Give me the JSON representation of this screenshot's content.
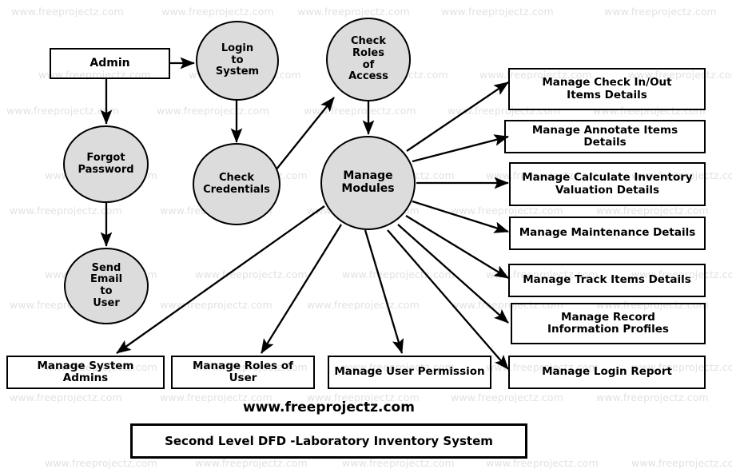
{
  "diagram": {
    "type": "Data Flow Diagram",
    "title": "Second Level DFD -Laboratory Inventory System",
    "brand": "www.freeprojectz.com",
    "watermark_text": "www.freeprojectz.com",
    "colors": {
      "process_fill": "#dcdcdc",
      "stroke": "#000000",
      "background": "#ffffff",
      "watermark": "#e2e2e2"
    }
  },
  "external_entities": [
    {
      "id": "admin",
      "label": "Admin"
    }
  ],
  "processes": [
    {
      "id": "login",
      "label": "Login\nto\nSystem",
      "lines": [
        "Login",
        "to",
        "System"
      ]
    },
    {
      "id": "roles",
      "label": "Check\nRoles\nof\nAccess",
      "lines": [
        "Check",
        "Roles",
        "of",
        "Access"
      ]
    },
    {
      "id": "forgot",
      "label": "Forgot\nPassword",
      "lines": [
        "Forgot",
        "Password"
      ]
    },
    {
      "id": "credentials",
      "label": "Check\nCredentials",
      "lines": [
        "Check",
        "Credentials"
      ]
    },
    {
      "id": "modules",
      "label": "Manage\nModules",
      "lines": [
        "Manage",
        "Modules"
      ]
    },
    {
      "id": "sendmail",
      "label": "Send\nEmail\nto\nUser",
      "lines": [
        "Send",
        "Email",
        "to",
        "User"
      ]
    }
  ],
  "data_stores_right": [
    {
      "id": "checkinout",
      "lines": [
        "Manage Check In/Out",
        "Items Details"
      ]
    },
    {
      "id": "annotate",
      "lines": [
        "Manage Annotate Items Details"
      ]
    },
    {
      "id": "valuation",
      "lines": [
        "Manage Calculate Inventory",
        "Valuation Details"
      ]
    },
    {
      "id": "maintenance",
      "lines": [
        "Manage Maintenance Details"
      ]
    },
    {
      "id": "trackitems",
      "lines": [
        "Manage Track Items Details"
      ]
    },
    {
      "id": "recordinfo",
      "lines": [
        "Manage Record",
        "Information Profiles"
      ]
    },
    {
      "id": "loginreport",
      "lines": [
        "Manage Login Report"
      ]
    }
  ],
  "data_stores_bottom": [
    {
      "id": "sysadmins",
      "lines": [
        "Manage System Admins"
      ]
    },
    {
      "id": "rolesofuser",
      "lines": [
        "Manage Roles of User"
      ]
    },
    {
      "id": "userpermission",
      "lines": [
        "Manage User Permission"
      ]
    }
  ],
  "flows": [
    {
      "from": "admin",
      "to": "login"
    },
    {
      "from": "admin",
      "to": "forgot"
    },
    {
      "from": "forgot",
      "to": "sendmail"
    },
    {
      "from": "login",
      "to": "credentials"
    },
    {
      "from": "credentials",
      "to": "roles"
    },
    {
      "from": "roles",
      "to": "modules"
    },
    {
      "from": "modules",
      "to": "checkinout"
    },
    {
      "from": "modules",
      "to": "annotate"
    },
    {
      "from": "modules",
      "to": "valuation"
    },
    {
      "from": "modules",
      "to": "maintenance"
    },
    {
      "from": "modules",
      "to": "trackitems"
    },
    {
      "from": "modules",
      "to": "recordinfo"
    },
    {
      "from": "modules",
      "to": "loginreport"
    },
    {
      "from": "modules",
      "to": "sysadmins"
    },
    {
      "from": "modules",
      "to": "rolesofuser"
    },
    {
      "from": "modules",
      "to": "userpermission"
    }
  ]
}
